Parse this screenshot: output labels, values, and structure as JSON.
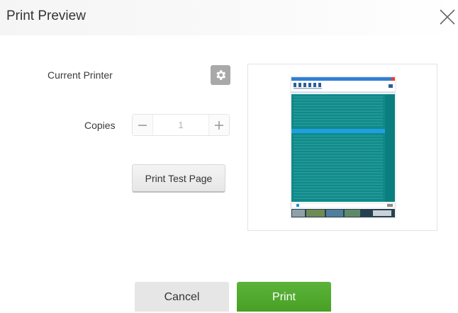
{
  "dialog": {
    "title": "Print Preview"
  },
  "settings": {
    "current_printer_label": "Current Printer",
    "copies_label": "Copies",
    "copies_value": "1",
    "test_page_label": "Print Test Page"
  },
  "actions": {
    "cancel_label": "Cancel",
    "print_label": "Print"
  },
  "icons": {
    "close": "close-icon",
    "printer_settings": "gear-icon",
    "decrement": "minus-icon",
    "increment": "plus-icon"
  },
  "colors": {
    "print_button": "#4caf2a",
    "preview_table": "#0e8a8a",
    "preview_highlight_row": "#1ea0e0"
  }
}
